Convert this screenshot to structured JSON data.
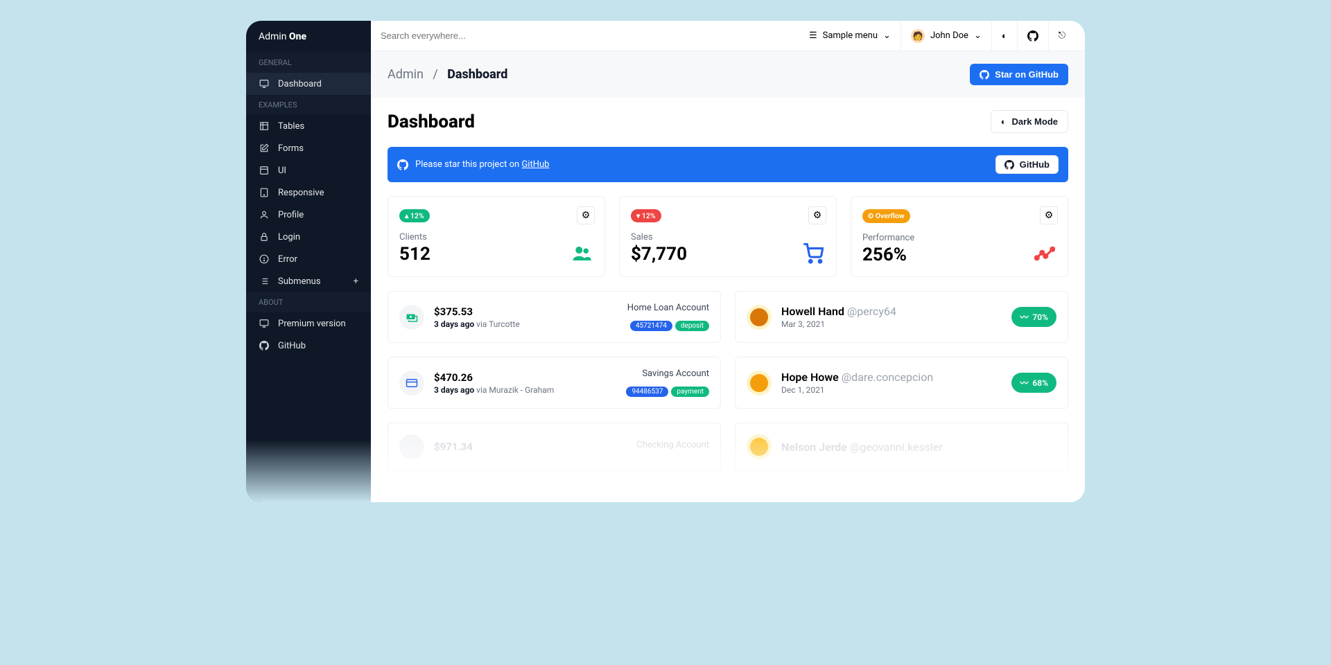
{
  "brand": {
    "part1": "Admin ",
    "part2": "One"
  },
  "sidebar": {
    "sections": [
      {
        "label": "GENERAL",
        "items": [
          {
            "label": "Dashboard",
            "icon": "monitor",
            "active": true
          }
        ]
      },
      {
        "label": "EXAMPLES",
        "items": [
          {
            "label": "Tables",
            "icon": "table"
          },
          {
            "label": "Forms",
            "icon": "edit"
          },
          {
            "label": "UI",
            "icon": "ui"
          },
          {
            "label": "Responsive",
            "icon": "responsive"
          },
          {
            "label": "Profile",
            "icon": "profile"
          },
          {
            "label": "Login",
            "icon": "lock"
          },
          {
            "label": "Error",
            "icon": "error"
          },
          {
            "label": "Submenus",
            "icon": "list",
            "expand": true
          }
        ]
      },
      {
        "label": "ABOUT",
        "items": [
          {
            "label": "Premium version",
            "icon": "monitor"
          },
          {
            "label": "GitHub",
            "icon": "github"
          }
        ]
      }
    ]
  },
  "topbar": {
    "search_placeholder": "Search everywhere...",
    "sample_menu": "Sample menu",
    "user": "John Doe"
  },
  "crumbs": {
    "root": "Admin",
    "sep": "/",
    "current": "Dashboard",
    "star_btn": "Star on GitHub"
  },
  "header": {
    "title": "Dashboard",
    "dark_btn": "Dark Mode"
  },
  "banner": {
    "text": "Please star this project on ",
    "link": "GitHub",
    "btn": "GitHub"
  },
  "stats": [
    {
      "pill": "12%",
      "pill_color": "green",
      "arrow": "up",
      "label": "Clients",
      "value": "512",
      "icon": "users",
      "icon_color": "#10b981"
    },
    {
      "pill": "12%",
      "pill_color": "red",
      "arrow": "down",
      "label": "Sales",
      "value": "$7,770",
      "icon": "cart",
      "icon_color": "#2563eb"
    },
    {
      "pill": "Overflow",
      "pill_color": "amber",
      "arrow": "alert",
      "label": "Performance",
      "value": "256%",
      "icon": "chart",
      "icon_color": "#ef4444"
    }
  ],
  "transactions": [
    {
      "amount": "$375.53",
      "ago": "3 days ago",
      "via": "via Turcotte",
      "account": "Home Loan Account",
      "code": "45721474",
      "tag": "deposit",
      "icon": "cash",
      "icon_color": "#10b981"
    },
    {
      "amount": "$470.26",
      "ago": "3 days ago",
      "via": "via Murazik - Graham",
      "account": "Savings Account",
      "code": "94486537",
      "tag": "payment",
      "icon": "card",
      "icon_color": "#2563eb"
    },
    {
      "amount": "$971.34",
      "ago": "",
      "via": "",
      "account": "Checking Account",
      "code": "",
      "tag": "",
      "icon": "",
      "icon_color": "",
      "faded": true
    }
  ],
  "people": [
    {
      "name": "Howell Hand",
      "handle": "@percy64",
      "date": "Mar 3, 2021",
      "pct": "70%",
      "avatar": "#d97706"
    },
    {
      "name": "Hope Howe",
      "handle": "@dare.concepcion",
      "date": "Dec 1, 2021",
      "pct": "68%",
      "avatar": "#f59e0b"
    },
    {
      "name": "Nelson Jerde",
      "handle": "@geovanni.kessler",
      "date": "",
      "pct": "",
      "avatar": "#fbbf24",
      "faded": true
    }
  ]
}
